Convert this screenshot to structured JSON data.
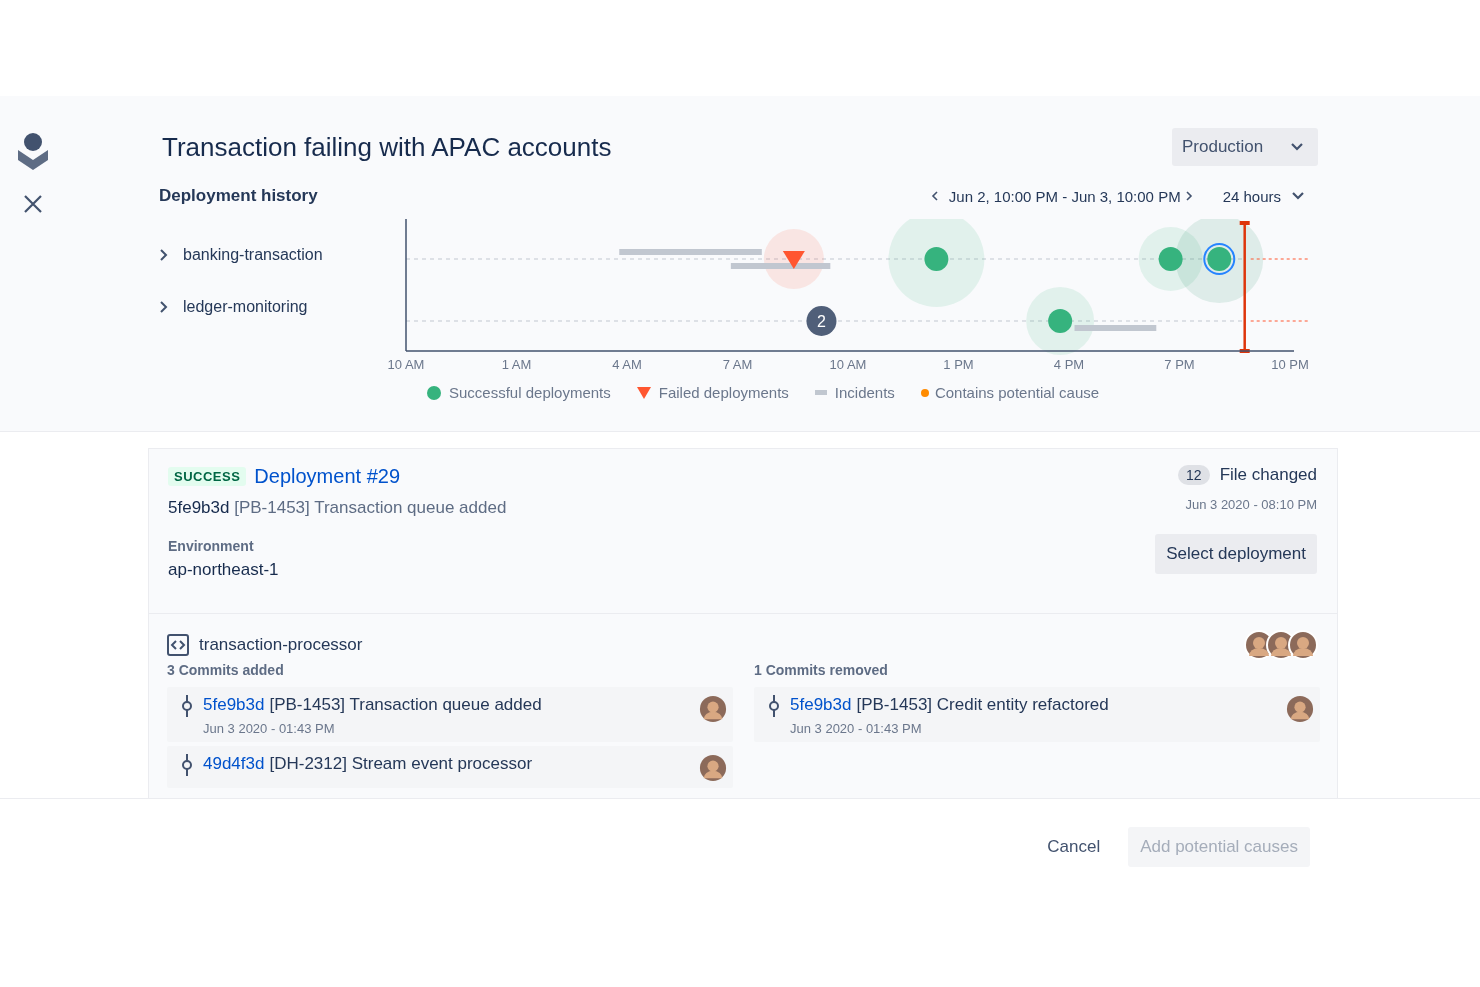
{
  "incident": {
    "title": "Transaction failing with APAC accounts",
    "environment_picker": "Production"
  },
  "deployment_history": {
    "title": "Deployment history",
    "range": "Jun 2, 10:00 PM - Jun 3, 10:00 PM",
    "period": "24 hours",
    "services": [
      {
        "name": "banking-transaction",
        "expanded": false
      },
      {
        "name": "ledger-monitoring",
        "expanded": false
      }
    ],
    "incident_count": "2",
    "axis_labels": [
      "10 AM",
      "1 AM",
      "4 AM",
      "7 AM",
      "10 AM",
      "1 PM",
      "4 PM",
      "7 PM",
      "10 PM"
    ],
    "legend": [
      {
        "label": "Successful deployments",
        "kind": "success"
      },
      {
        "label": "Failed deployments",
        "kind": "failed"
      },
      {
        "label": "Incidents",
        "kind": "incident"
      },
      {
        "label": "Contains potential cause",
        "kind": "cause"
      }
    ]
  },
  "deployment": {
    "status": "SUCCESS",
    "title": "Deployment #29",
    "commit_hash": "5fe9b3d",
    "commit_message": "[PB-1453] Transaction queue added",
    "files_count": "12",
    "files_label": "File changed",
    "date": "Jun 3 2020 - 08:10 PM",
    "environment_label": "Environment",
    "environment": "ap-northeast-1",
    "select_button": "Select deployment"
  },
  "repository": {
    "name": "transaction-processor",
    "added": {
      "title": "3 Commits added",
      "commits": [
        {
          "hash": "5fe9b3d",
          "message": "[PB-1453] Transaction queue added",
          "date": "Jun 3 2020 - 01:43 PM"
        },
        {
          "hash": "49d4f3d",
          "message": "[DH-2312] Stream event processor"
        }
      ]
    },
    "removed": {
      "title": "1 Commits removed",
      "commits": [
        {
          "hash": "5fe9b3d",
          "message": "[PB-1453] Credit entity refactored",
          "date": "Jun 3 2020 - 01:43 PM"
        }
      ]
    }
  },
  "footer": {
    "cancel": "Cancel",
    "submit": "Add potential causes",
    "submit_disabled": true
  }
}
